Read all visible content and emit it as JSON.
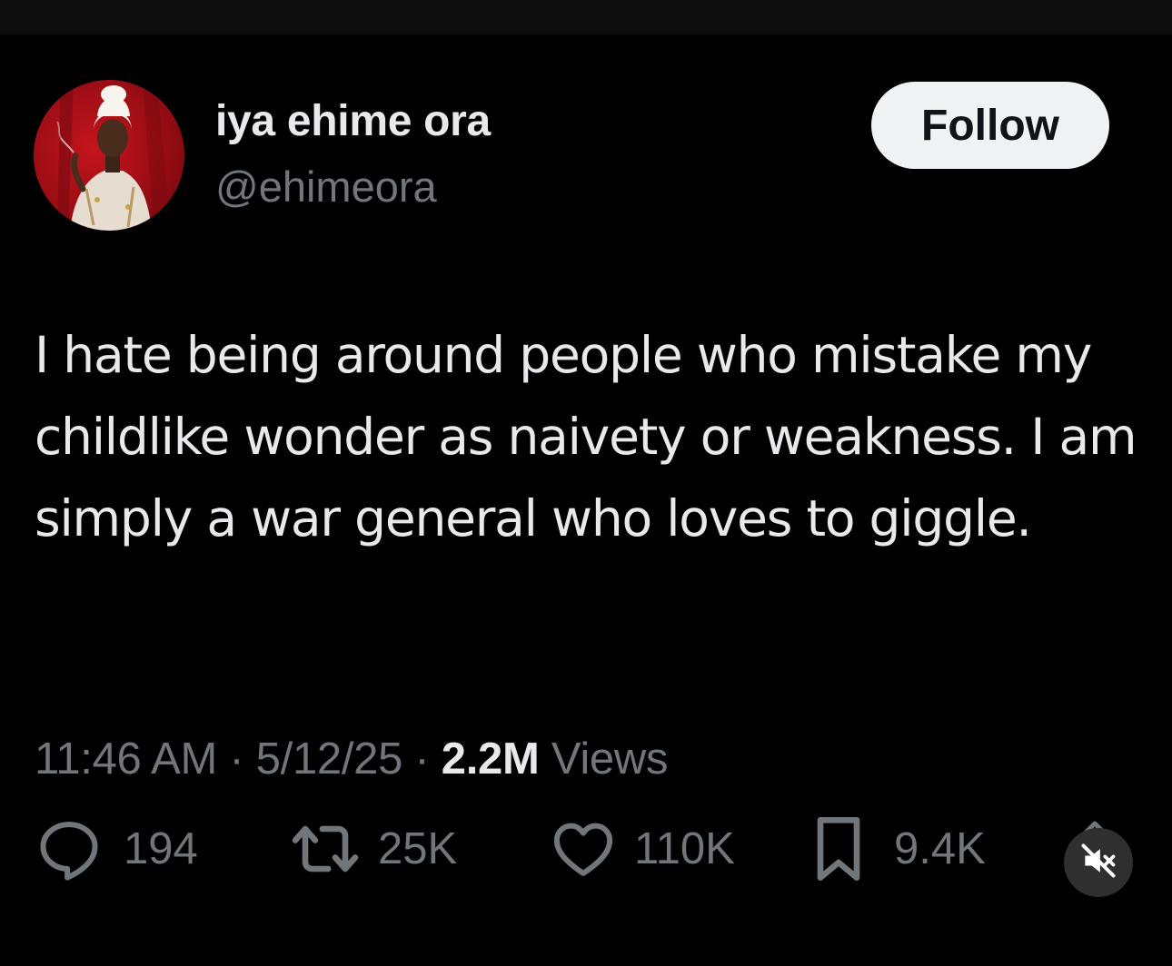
{
  "author": {
    "display_name": "iya ehime ora",
    "handle": "@ehimeora",
    "avatar_icon": "profile-photo"
  },
  "follow_label": "Follow",
  "tweet": {
    "text": "I hate being around people who mistake my childlike wonder as naivety or weakness. I am simply a war general who loves to giggle."
  },
  "meta": {
    "time": "11:46 AM",
    "separator": "·",
    "date": "5/12/25",
    "views_count": "2.2M",
    "views_label": "Views"
  },
  "actions": {
    "replies": {
      "icon": "reply-icon",
      "count": "194"
    },
    "reposts": {
      "icon": "repost-icon",
      "count": "25K"
    },
    "likes": {
      "icon": "heart-icon",
      "count": "110K"
    },
    "bookmarks": {
      "icon": "bookmark-icon",
      "count": "9.4K"
    }
  },
  "mute_icon": "muted-speaker-icon",
  "colors": {
    "background": "#000000",
    "text_primary": "#e7e9ea",
    "text_secondary": "#71767b",
    "follow_bg": "#eff3f4"
  }
}
